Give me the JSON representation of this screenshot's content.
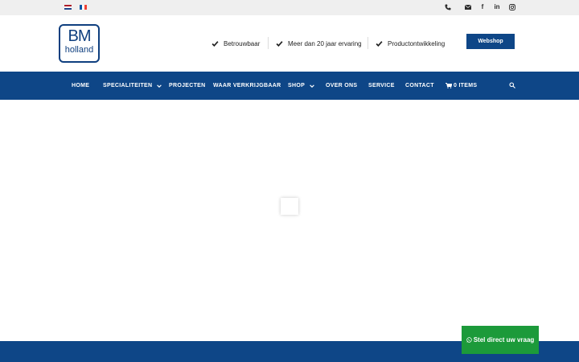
{
  "topbar": {
    "languages": [
      {
        "code": "nl",
        "icon": "flag-nl-icon"
      },
      {
        "code": "fr",
        "icon": "flag-fr-icon"
      }
    ],
    "social": {
      "facebook_glyph": "f",
      "linkedin_glyph": "in"
    }
  },
  "header": {
    "logo": {
      "line1": "BM",
      "line2": "holland"
    },
    "usps": [
      "Betrouwbaar",
      "Meer dan 20 jaar ervaring",
      "Productontwikkeling"
    ],
    "webshop_label": "Webshop"
  },
  "nav": {
    "items": [
      "HOME",
      "SPECIALITEITEN",
      "PROJECTEN",
      "WAAR VERKRIJGBAAR",
      "SHOP",
      "OVER ONS",
      "SERVICE",
      "CONTACT"
    ],
    "cart_label": "0 ITEMS"
  },
  "chat": {
    "label": "Stel direct uw vraag"
  },
  "colors": {
    "brand_blue": "#0e4687",
    "whatsapp_green": "#1c9a3a",
    "topbar_gray": "#efefef"
  }
}
